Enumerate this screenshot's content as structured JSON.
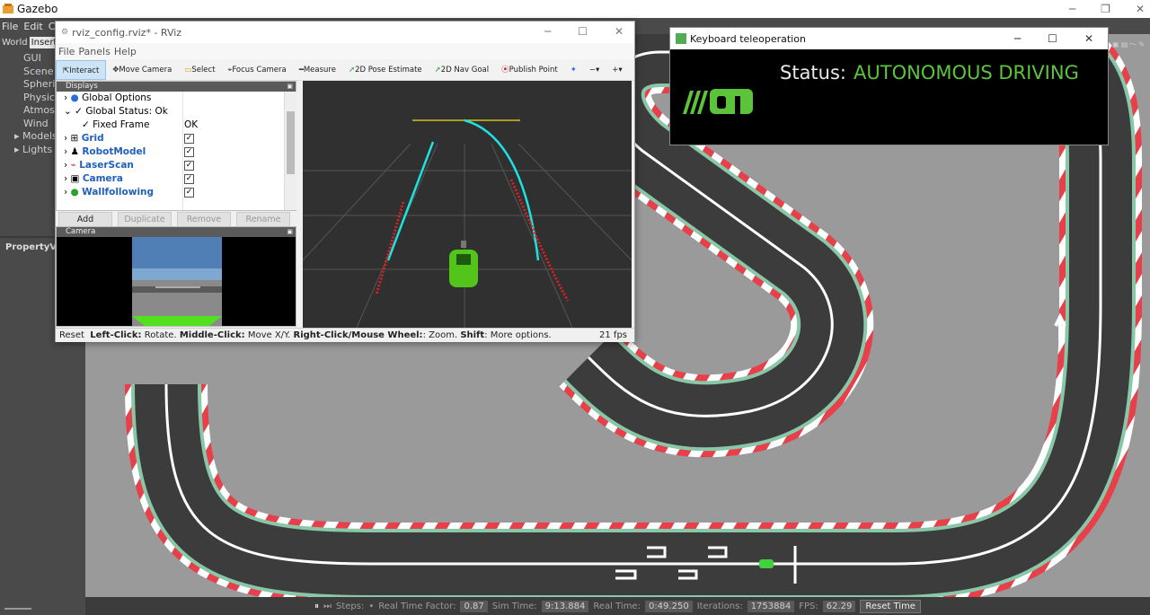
{
  "gazebo": {
    "title": "Gazebo",
    "menu": [
      "File",
      "Edit",
      "Cam"
    ],
    "tabs": [
      "World",
      "Insert"
    ],
    "tree_items": [
      "GUI",
      "Scene",
      "Spheric",
      "Physics",
      "Atmosp",
      "Wind",
      "Models",
      "Lights"
    ],
    "property_label": "PropertyVa",
    "statusbar": {
      "steps_label": "Steps:",
      "rtf_label": "Real Time Factor:",
      "rtf_value": "0.87",
      "simtime_label": "Sim Time:",
      "simtime_value": "9:13.884",
      "realtime_label": "Real Time:",
      "realtime_value": "0:49.250",
      "iterations_label": "Iterations:",
      "iterations_value": "1753884",
      "fps_label": "FPS:",
      "fps_value": "62.29",
      "reset_label": "Reset Time"
    }
  },
  "rviz": {
    "title": "rviz_config.rviz* - RViz",
    "menu": [
      "File",
      "Panels",
      "Help"
    ],
    "tools": [
      "Interact",
      "Move Camera",
      "Select",
      "Focus Camera",
      "Measure",
      "2D Pose Estimate",
      "2D Nav Goal",
      "Publish Point"
    ],
    "displays_title": "Displays",
    "displays": [
      {
        "name": "Global Options",
        "value": ""
      },
      {
        "name": "Global Status: Ok",
        "value": ""
      },
      {
        "name": "Fixed Frame",
        "value": "OK"
      },
      {
        "name": "Grid",
        "value": "checked"
      },
      {
        "name": "RobotModel",
        "value": "checked"
      },
      {
        "name": "LaserScan",
        "value": "checked"
      },
      {
        "name": "Camera",
        "value": "checked"
      },
      {
        "name": "Wallfollowing",
        "value": "checked"
      }
    ],
    "buttons": [
      "Add",
      "Duplicate",
      "Remove",
      "Rename"
    ],
    "camera_title": "Camera",
    "status": {
      "reset": "Reset",
      "left": "Left-Click:",
      "left_txt": "Rotate.",
      "middle": "Middle-Click:",
      "middle_txt": "Move X/Y.",
      "right": "Right-Click/Mouse Wheel:",
      "right_txt": ": Zoom.",
      "shift": "Shift",
      "shift_txt": ": More options.",
      "fps": "21 fps"
    }
  },
  "teleop": {
    "title": "Keyboard teleoperation",
    "status_label": "Status:",
    "status_value": "AUTONOMOUS DRIVING",
    "colors": {
      "status": "#5cc43b",
      "logo": "#5cc43b"
    }
  }
}
